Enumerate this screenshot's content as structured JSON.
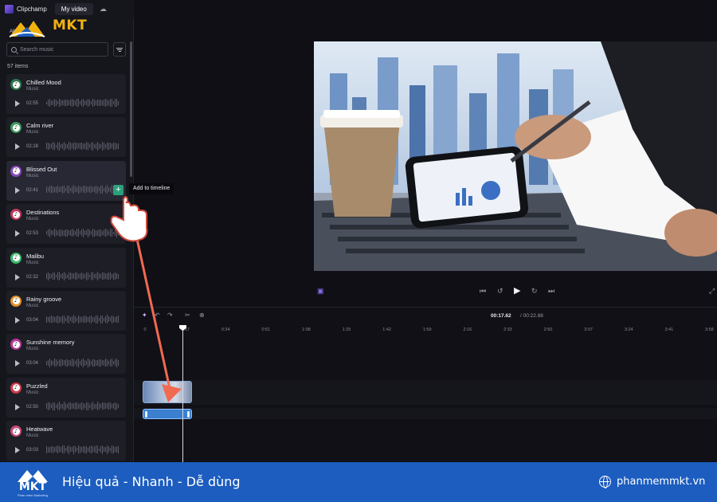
{
  "app": {
    "name": "Clipchamp",
    "tab": "My video"
  },
  "watermark": {
    "brand": "MKT"
  },
  "sidebar": {
    "filter_all": "All",
    "search_placeholder": "Search music",
    "items_count": "57 items",
    "tooltip": "Add to timeline",
    "tracks": [
      {
        "title": "Chilled Mood",
        "category": "Music",
        "duration": "02:55",
        "color": "#2b7a4b"
      },
      {
        "title": "Calm river",
        "category": "Music",
        "duration": "02:28",
        "color": "#3a9a5a"
      },
      {
        "title": "Blissed Out",
        "category": "Music",
        "duration": "02:41",
        "color": "#8a4ab8"
      },
      {
        "title": "Destinations",
        "category": "Music",
        "duration": "02:53",
        "color": "#c03a5a"
      },
      {
        "title": "Malibu",
        "category": "Music",
        "duration": "02:32",
        "color": "#3ab86a"
      },
      {
        "title": "Rainy groove",
        "category": "Music",
        "duration": "03:04",
        "color": "#e0902a"
      },
      {
        "title": "Sunshine memory",
        "category": "Music",
        "duration": "03:04",
        "color": "#b83a9a"
      },
      {
        "title": "Puzzled",
        "category": "Music",
        "duration": "02:50",
        "color": "#d03a4a"
      },
      {
        "title": "Heatwave",
        "category": "Music",
        "duration": "03:03",
        "color": "#c84a7a"
      }
    ]
  },
  "timeline": {
    "current_time": "00:17.62",
    "separator": "/",
    "total_time": "00:22.88",
    "ticks": [
      "0",
      "0:17",
      "0:34",
      "0:51",
      "1:08",
      "1:25",
      "1:42",
      "1:59",
      "2:16",
      "2:33",
      "2:50",
      "3:07",
      "3:24",
      "3:41",
      "3:58"
    ]
  },
  "banner": {
    "logo_text": "MKT",
    "logo_subtext": "Phần mềm Marketing",
    "slogan": "Hiệu quả - Nhanh  - Dễ dùng",
    "website": "phanmemmkt.vn"
  }
}
